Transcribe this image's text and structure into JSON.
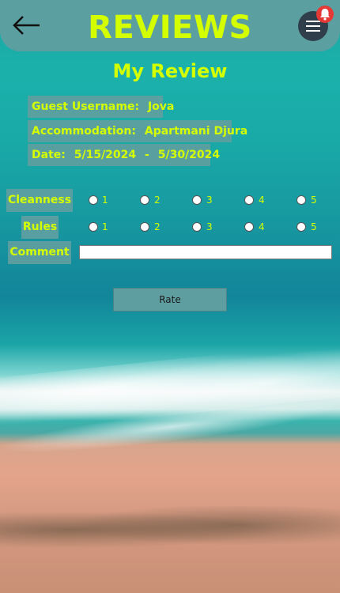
{
  "header": {
    "title": "REVIEWS",
    "back_icon": "arrow-left-icon",
    "menu_icon": "hamburger-menu-icon",
    "notification_icon": "bell-icon"
  },
  "review": {
    "heading": "My Review",
    "guest_label": "Guest Username:",
    "guest_value": "Jova",
    "accommodation_label": "Accommodation:",
    "accommodation_value": "Apartmani Djura",
    "date_label": "Date:",
    "date_start": "5/15/2024",
    "date_separator": "-",
    "date_end": "5/30/2024"
  },
  "ratings": [
    {
      "label": "Cleanness",
      "options": [
        "1",
        "2",
        "3",
        "4",
        "5"
      ],
      "selected": null
    },
    {
      "label": "Rules",
      "options": [
        "1",
        "2",
        "3",
        "4",
        "5"
      ],
      "selected": null
    }
  ],
  "comment": {
    "label": "Comment",
    "value": ""
  },
  "actions": {
    "rate_label": "Rate"
  },
  "colors": {
    "accent": "#d4ff00",
    "panel": "#5f9ea0",
    "badge": "#e53935",
    "menu_button": "#2f3e4a"
  }
}
